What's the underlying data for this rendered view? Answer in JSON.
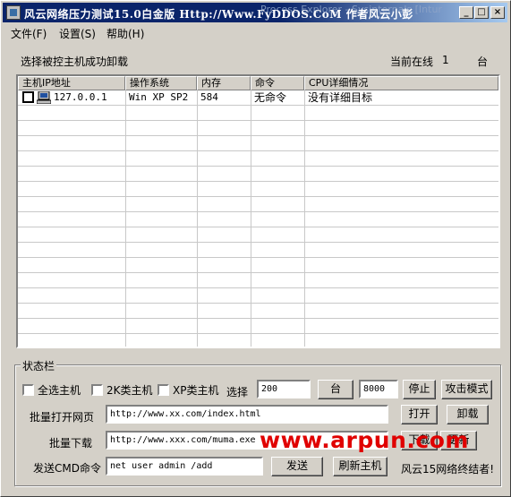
{
  "window": {
    "title": "风云网络压力测试15.0白金版 Http://Www.FyDDOS.CoM 作者风云小彭",
    "background_window_title": "Process Explorer - Sysinternals [Intur"
  },
  "menu": {
    "items": [
      {
        "label": "文件(F)"
      },
      {
        "label": "设置(S)"
      },
      {
        "label": "帮助(H)"
      }
    ]
  },
  "status": {
    "unload_message": "选择被控主机成功卸载",
    "online_label": "当前在线",
    "online_count": "1",
    "online_unit": "台"
  },
  "table": {
    "columns": [
      "主机IP地址",
      "操作系统",
      "内存",
      "命令",
      "CPU详细情况"
    ],
    "rows": [
      {
        "ip": "127.0.0.1",
        "os": "Win XP SP2",
        "memory": "584",
        "command": "无命令",
        "cpu": "没有详细目标"
      }
    ]
  },
  "statusbar": {
    "group_title": "状态栏",
    "select_all_label": "全选主机",
    "k2_label": "2K类主机",
    "xp_label": "XP类主机",
    "select_label": "选择",
    "select_count": "200",
    "unit_button": "台",
    "threads": "8000",
    "stop_button": "停止",
    "attack_mode_button": "攻击模式",
    "batch_open_label": "批量打开网页",
    "batch_open_url": "http://www.xx.com/index.html",
    "open_button": "打开",
    "unload_button": "卸载",
    "batch_download_label": "批量下载",
    "batch_download_url": "http://www.xxx.com/muma.exe",
    "download_button": "下载",
    "update_button": "更新",
    "cmd_label": "发送CMD命令",
    "cmd_value": "net user admin /add",
    "send_button": "发送",
    "refresh_button": "刷新主机",
    "footer_text": "风云15网络终结者!"
  },
  "watermark": "www.arpun.com"
}
